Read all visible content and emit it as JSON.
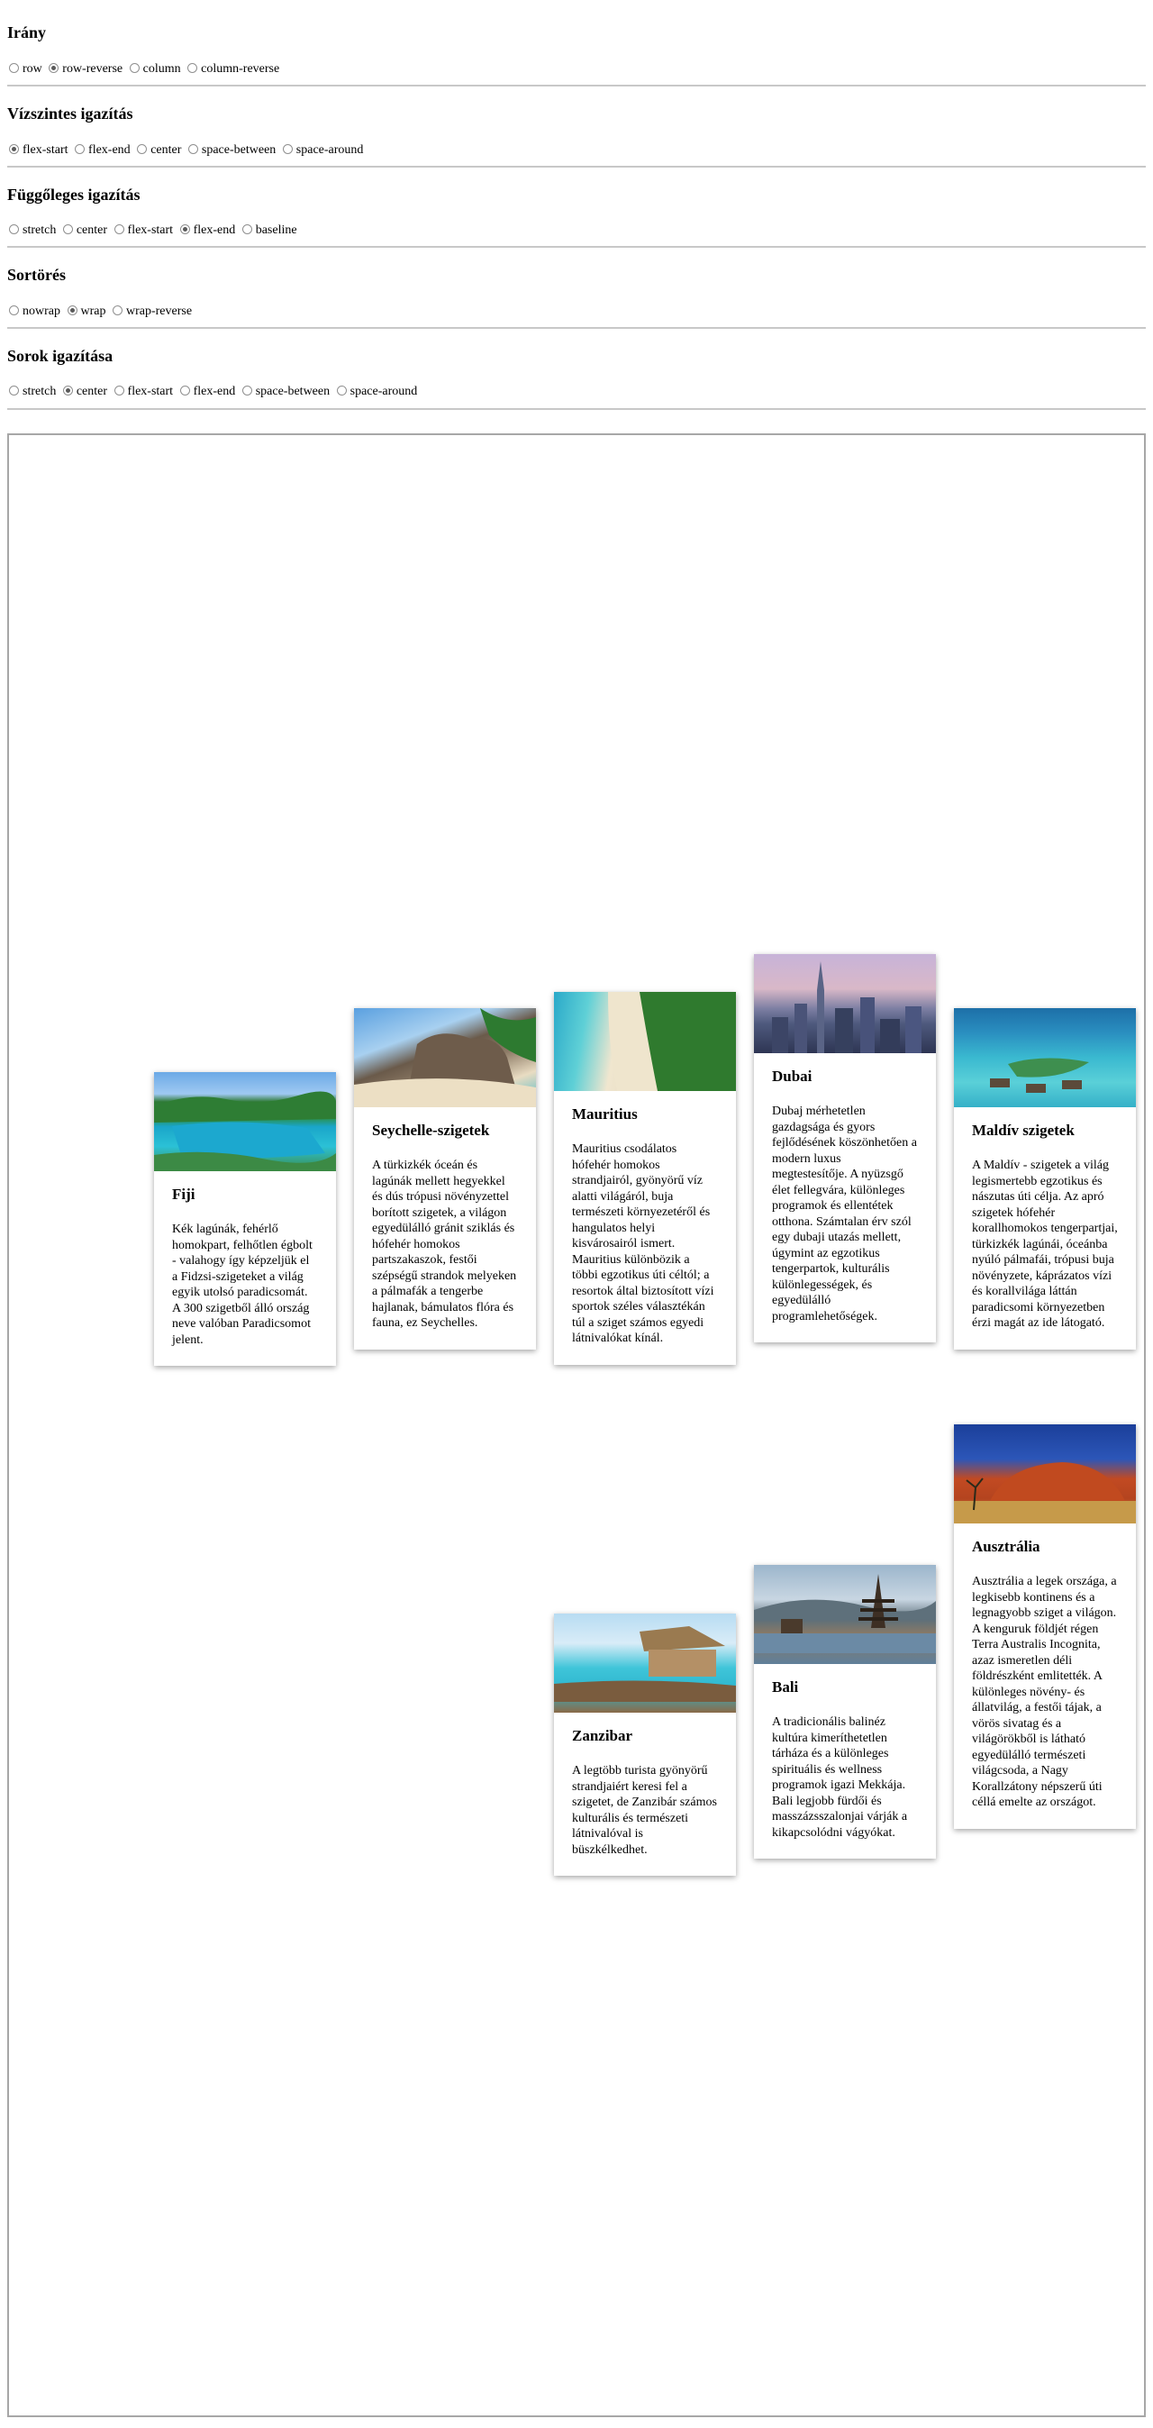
{
  "sections": [
    {
      "title": "Irány",
      "options": [
        "row",
        "row-reverse",
        "column",
        "column-reverse"
      ],
      "selected": 1
    },
    {
      "title": "Vízszintes igazítás",
      "options": [
        "flex-start",
        "flex-end",
        "center",
        "space-between",
        "space-around"
      ],
      "selected": 0
    },
    {
      "title": "Függőleges igazítás",
      "options": [
        "stretch",
        "center",
        "flex-start",
        "flex-end",
        "baseline"
      ],
      "selected": 3
    },
    {
      "title": "Sortörés",
      "options": [
        "nowrap",
        "wrap",
        "wrap-reverse"
      ],
      "selected": 1
    },
    {
      "title": "Sorok igazítása",
      "options": [
        "stretch",
        "center",
        "flex-start",
        "flex-end",
        "space-between",
        "space-around"
      ],
      "selected": 1
    }
  ],
  "cards": [
    {
      "title": "Fiji",
      "text": "Kék lagúnák, fehérlő homokpart, felhőtlen égbolt - valahogy így képzeljük el a Fidzsi-szigeteket a világ egyik utolsó paradicsomát. A 300 szigetből álló ország neve valóban Paradicsomot jelent.",
      "image": "fiji-island-photo"
    },
    {
      "title": "Seychelle-szigetek",
      "text": "A türkizkék óceán és lagúnák mellett hegyekkel és dús trópusi növényzettel borított szigetek, a világon egyedülálló gránit sziklás és hófehér homokos partszakaszok, festői szépségű strandok melyeken a pálmafák a tengerbe hajlanak, bámulatos flóra és fauna, ez Seychelles.",
      "image": "seychelles-beach-photo"
    },
    {
      "title": "Mauritius",
      "text": "Mauritius csodálatos hófehér homokos strandjairól, gyönyörű víz alatti világáról, buja természeti környezetéről és hangulatos helyi kisvárosairól ismert. Mauritius különbözik a többi egzotikus úti céltól; a resortok által biztosított vízi sportok széles választékán túl a sziget számos egyedi látnivalókat kínál.",
      "image": "mauritius-coast-photo"
    },
    {
      "title": "Dubai",
      "text": "Dubaj mérhetetlen gazdagsága és gyors fejlődésének köszönhetően a modern luxus megtestesítője. A nyüzsgő élet fellegvára, különleges programok és ellentétek otthona. Számtalan érv szól egy dubaji utazás mellett, úgymint az egzotikus tengerpartok, kulturális különlegességek, és egyedülálló programlehetőségek.",
      "image": "dubai-skyline-photo"
    },
    {
      "title": "Maldív szigetek",
      "text": "A Maldív - szigetek a világ legismertebb egzotikus és nászutas úti célja. Az apró szigetek hófehér korallhomokos tengerpartjai, türkizkék lagúnái, óceánba nyúló pálmafái, trópusi buja növényzete, káprázatos vízi és korallvilága láttán paradicsomi környezetben érzi magát az ide látogató.",
      "image": "maldives-bungalows-photo"
    },
    {
      "title": "Zanzibar",
      "text": "A legtöbb turista gyönyörű strandjaiért keresi fel a szigetet, de Zanzibár számos kulturális és természeti látnivalóval is büszkélkedhet.",
      "image": "zanzibar-hut-photo"
    },
    {
      "title": "Bali",
      "text": "A tradicionális balinéz kultúra kimeríthetetlen tárháza és a különleges spirituális és wellness programok igazi Mekkája. Bali legjobb fürdői és masszázsszalonjai várják a kikapcsolódni vágyókat.",
      "image": "bali-temple-photo"
    },
    {
      "title": "Ausztrália",
      "text": "Ausztrália a legek országa, a legkisebb kontinens és a legnagyobb sziget a világon. A kenguruk földjét régen Terra Australis Incognita, azaz ismeretlen déli földrészként emlitették. A különleges növény- és állatvilág, a festői tájak, a vörös sivatag és a világörökből is látható egyedülálló természeti világcsoda, a Nagy Korallzátony népszerű úti céllá emelte az országot.",
      "image": "australia-uluru-photo"
    }
  ]
}
